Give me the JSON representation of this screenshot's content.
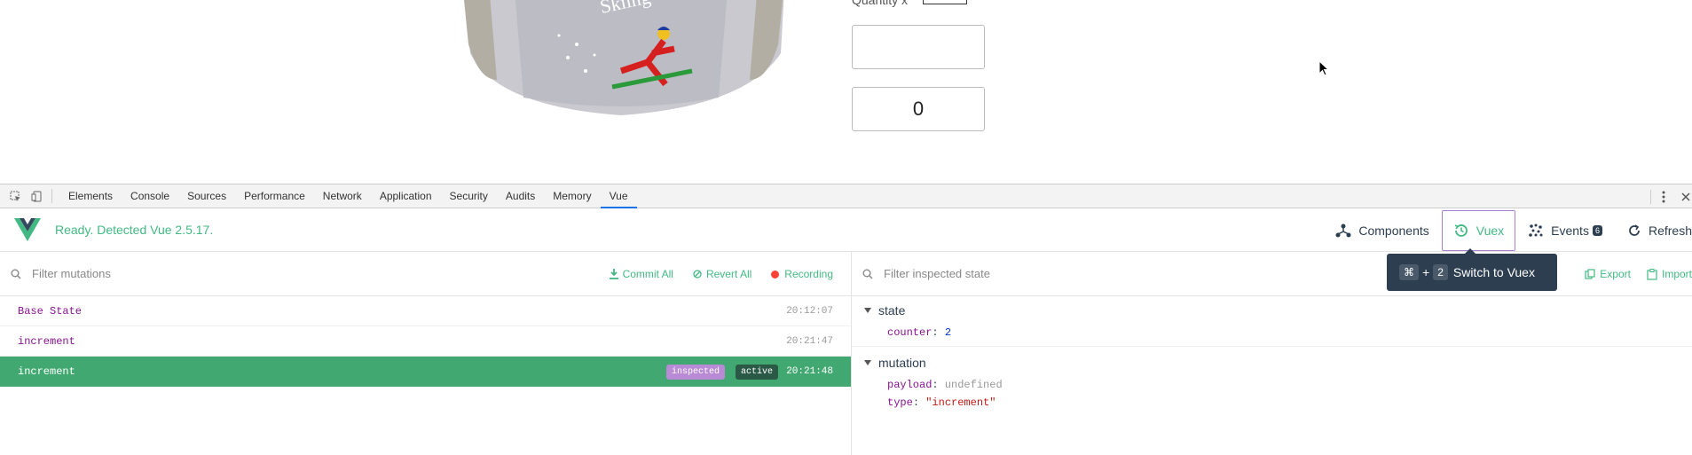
{
  "page": {
    "quantity_label": "Quantity x",
    "field_top_value": "",
    "field_counter_value": "0"
  },
  "devtools": {
    "tabs": [
      "Elements",
      "Console",
      "Sources",
      "Performance",
      "Network",
      "Application",
      "Security",
      "Audits",
      "Memory",
      "Vue"
    ],
    "active_tab": "Vue"
  },
  "vue": {
    "status": "Ready. Detected Vue 2.5.17.",
    "nav": {
      "components": "Components",
      "vuex": "Vuex",
      "events": "Events",
      "events_count": "6",
      "refresh": "Refresh"
    },
    "tooltip": {
      "key1": "⌘",
      "plus": "+",
      "key2": "2",
      "text": "Switch to Vuex"
    },
    "mutations": {
      "filter_placeholder": "Filter mutations",
      "commit_all": "Commit All",
      "revert_all": "Revert All",
      "recording": "Recording",
      "items": [
        {
          "name": "Base State",
          "time": "20:12:07"
        },
        {
          "name": "increment",
          "time": "20:21:47"
        },
        {
          "name": "increment",
          "time": "20:21:48",
          "tag_inspected": "inspected",
          "tag_active": "active"
        }
      ]
    },
    "inspector": {
      "filter_placeholder": "Filter inspected state",
      "export": "Export",
      "import": "Import",
      "state_title": "state",
      "counter_key": "counter",
      "counter_value": "2",
      "mutation_title": "mutation",
      "payload_key": "payload",
      "payload_value": "undefined",
      "type_key": "type",
      "type_value": "\"increment\""
    }
  },
  "colors": {
    "accent": "#42b983",
    "selected_row": "#42a872",
    "inspected_tag": "#b98ad6"
  }
}
